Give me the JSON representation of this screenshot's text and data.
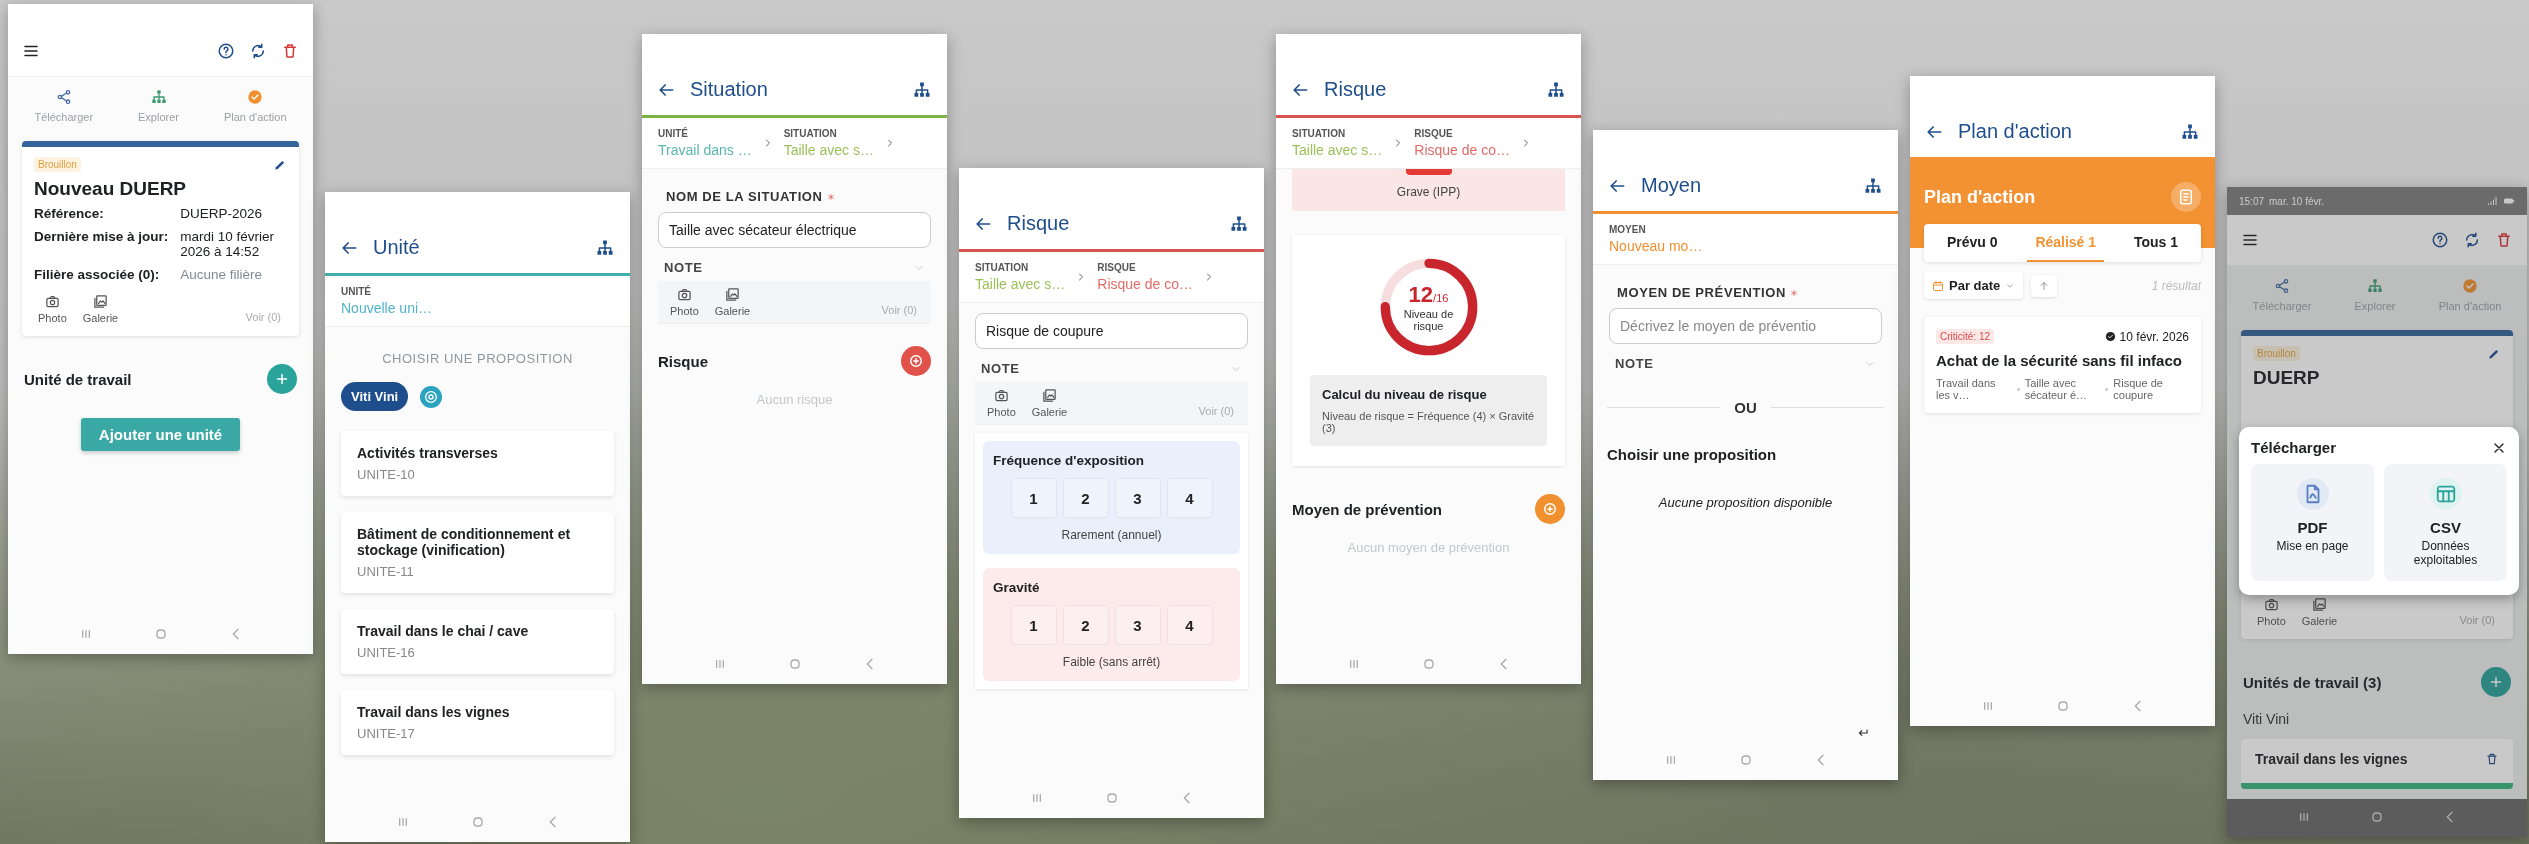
{
  "screens": [
    {
      "kind": "home",
      "actions": [
        "Télécharger",
        "Explorer",
        "Plan d'action"
      ],
      "badge": "Brouillon",
      "title": "Nouveau DUERP",
      "fields": [
        {
          "label": "Référence:",
          "value": "DUERP-2026"
        },
        {
          "label": "Dernière mise à jour:",
          "value": "mardi 10 février 2026 à 14:52"
        },
        {
          "label": "Filière associée (0):",
          "value": "Aucune filière"
        }
      ],
      "media": {
        "photo": "Photo",
        "gallery": "Galerie",
        "view": "Voir (0)"
      },
      "section": "Unité de travail",
      "button": "Ajouter une unité"
    },
    {
      "kind": "unit_list",
      "header": "Unité",
      "color": "#3fb0ad",
      "crumbs": [
        {
          "label": "UNITÉ",
          "value": "Nouvelle uni…",
          "color": "#4fb3c8"
        }
      ],
      "prompt": "CHOISIR UNE PROPOSITION",
      "chips": [
        {
          "label": "Viti Vini",
          "selected": true
        }
      ],
      "items": [
        {
          "name": "Activités transverses",
          "code": "UNITE-10"
        },
        {
          "name": "Bâtiment de conditionnement et stockage (vinification)",
          "code": "UNITE-11"
        },
        {
          "name": "Travail dans le chai / cave",
          "code": "UNITE-16"
        },
        {
          "name": "Travail dans les vignes",
          "code": "UNITE-17"
        }
      ]
    },
    {
      "kind": "situation",
      "header": "Situation",
      "color": "#7cb342",
      "crumbs": [
        {
          "label": "UNITÉ",
          "value": "Travail dans …",
          "color": "#5ab5b0"
        },
        {
          "label": "SITUATION",
          "value": "Taille avec s…",
          "color": "#9cc05a"
        }
      ],
      "field": {
        "label": "NOM DE LA SITUATION",
        "required": true,
        "value": "Taille avec sécateur électrique"
      },
      "note": "NOTE",
      "media": {
        "photo": "Photo",
        "gallery": "Galerie",
        "view": "Voir (0)"
      },
      "section": {
        "title": "Risque",
        "color": "#e0524a",
        "empty": "Aucun risque"
      }
    },
    {
      "kind": "risk_form",
      "header": "Risque",
      "color": "#d9534f",
      "crumbs": [
        {
          "label": "SITUATION",
          "value": "Taille avec s…",
          "color": "#9cc05a"
        },
        {
          "label": "RISQUE",
          "value": "Risque de co…",
          "color": "#e06c67"
        }
      ],
      "input": "Risque de coupure",
      "note": "NOTE",
      "media": {
        "photo": "Photo",
        "gallery": "Galerie",
        "view": "Voir (0)"
      },
      "scales": [
        {
          "title": "Fréquence d'exposition",
          "options": [
            "1",
            "2",
            "3",
            "4"
          ],
          "caption": "Rarement (annuel)",
          "color": "#e9f0fb"
        },
        {
          "title": "Gravité",
          "options": [
            "1",
            "2",
            "3",
            "4"
          ],
          "caption": "Faible (sans arrêt)",
          "color": "#fdeaea"
        }
      ]
    },
    {
      "kind": "risk_score",
      "header": "Risque",
      "color": "#d9534f",
      "crumbs": [
        {
          "label": "SITUATION",
          "value": "Taille avec s…",
          "color": "#9cc05a"
        },
        {
          "label": "RISQUE",
          "value": "Risque de co…",
          "color": "#e06c67"
        }
      ],
      "severity": "Grave (IPP)",
      "score": {
        "value": "12",
        "max": "/16",
        "label": "Niveau de risque",
        "level": 0.75
      },
      "calc": {
        "title": "Calcul du niveau de risque",
        "text": "Niveau de risque = Fréquence (4) × Gravité (3)"
      },
      "section": {
        "title": "Moyen de prévention",
        "color": "#f0902e",
        "empty": "Aucun moyen de prévention"
      }
    },
    {
      "kind": "means_form",
      "header": "Moyen",
      "color": "#f0902e",
      "crumbs": [
        {
          "label": "MOYEN",
          "value": "Nouveau mo…",
          "color": "#f0902e"
        }
      ],
      "field": {
        "label": "MOYEN DE PRÉVENTION",
        "required": true,
        "placeholder": "Décrivez le moyen de préventio"
      },
      "note": "NOTE",
      "divider": "OU",
      "proposals": "Choisir une proposition",
      "empty": "Aucune proposition disponible"
    },
    {
      "kind": "action_plan",
      "header": "Plan d'action",
      "color": "#f39233",
      "banner": "Plan d'action",
      "tabs": [
        {
          "label": "Prévu 0",
          "selected": false
        },
        {
          "label": "Réalisé 1",
          "selected": true
        },
        {
          "label": "Tous 1",
          "selected": false
        }
      ],
      "sort": "Par date",
      "results": "1 résultat",
      "card": {
        "badge": "Criticité: 12",
        "date": "10 févr. 2026",
        "title": "Achat de la sécurité sans fil infaco",
        "tags": [
          "Travail dans les v…",
          "Taille avec sécateur é…",
          "Risque de coupure"
        ]
      }
    },
    {
      "kind": "home",
      "status": {
        "time": "15:07",
        "date": "mar. 10 févr."
      },
      "actions": [
        "Télécharger",
        "Explorer",
        "Plan d'action"
      ],
      "badge": "Brouillon",
      "title": "DUERP",
      "media": {
        "photo": "Photo",
        "gallery": "Galerie",
        "view": "Voir (0)"
      },
      "section": "Unités de travail (3)",
      "group": "Viti Vini",
      "unit": "Travail dans les vignes",
      "dialog": {
        "title": "Télécharger",
        "options": [
          {
            "kind": "pdf",
            "title": "PDF",
            "subtitle": "Mise en page"
          },
          {
            "kind": "csv",
            "title": "CSV",
            "subtitle": "Données exploitables"
          }
        ]
      }
    }
  ]
}
